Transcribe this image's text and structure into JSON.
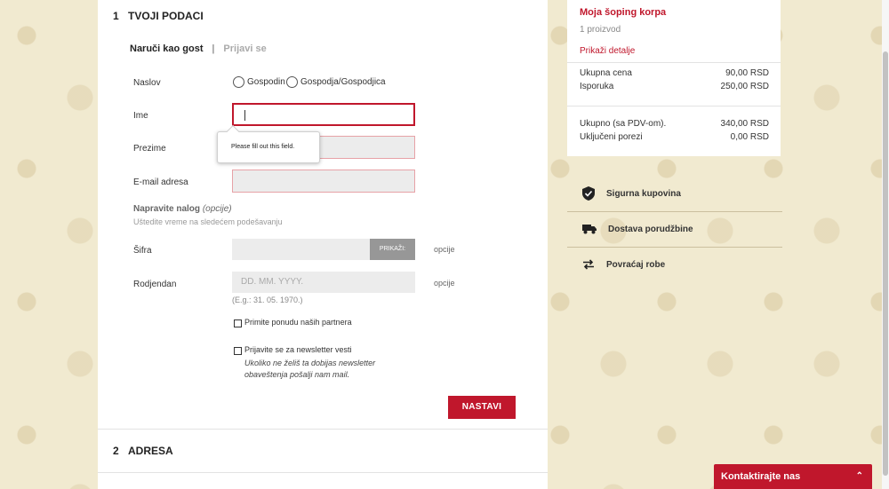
{
  "sections": [
    {
      "number": "1",
      "title": "TVOJI PODACI"
    },
    {
      "number": "2",
      "title": "ADRESA"
    }
  ],
  "tabs": {
    "active": "Naruči kao gost",
    "separator": "|",
    "inactive": "Prijavi se"
  },
  "form": {
    "title_label": "Naslov",
    "radio_mr": "Gospodin",
    "radio_mrs": "Gospodja/Gospodjica",
    "first_name_label": "Ime",
    "last_name_label": "Prezime",
    "email_label": "E-mail adresa",
    "tooltip": "Please fill out this field.",
    "create_account": "Napravite nalog",
    "create_account_optional": "(opcije)",
    "create_account_note": "Uštedite vreme na sledećem podešavanju",
    "password_label": "Šifra",
    "show_button": "PRIKAŽI:",
    "optional": "opcije",
    "birthday_label": "Rodjendan",
    "birthday_placeholder": "DD. MM. YYYY.",
    "birthday_hint": "(E.g.: 31. 05. 1970.)",
    "partner_offers": "Primite ponudu naših partnera",
    "newsletter": "Prijavite se za newsletter vesti",
    "newsletter_note": "Ukoliko ne želiš ta dobijas newsletter obaveštenja pošalji nam mail.",
    "continue_button": "NASTAVI"
  },
  "cart": {
    "title": "Moja šoping korpa",
    "count": "1 proizvod",
    "details_link": "Prikaži detalje",
    "rows": [
      {
        "label": "Ukupna cena",
        "value": "90,00 RSD"
      },
      {
        "label": "Isporuka",
        "value": "250,00 RSD"
      },
      {
        "label": "Ukupno (sa PDV-om).",
        "value": "340,00 RSD"
      },
      {
        "label": "Uključeni porezi",
        "value": "0,00 RSD"
      }
    ]
  },
  "features": [
    {
      "label": "Sigurna kupovina",
      "icon": "shield-check-icon"
    },
    {
      "label": "Dostava porudžbine",
      "icon": "truck-icon"
    },
    {
      "label": "Povraćaj robe",
      "icon": "exchange-arrows-icon"
    }
  ],
  "contact": {
    "label": "Kontaktirajte nas",
    "chevron": "⌃"
  },
  "colors": {
    "accent": "#c0172c",
    "background": "#f1ead0"
  }
}
